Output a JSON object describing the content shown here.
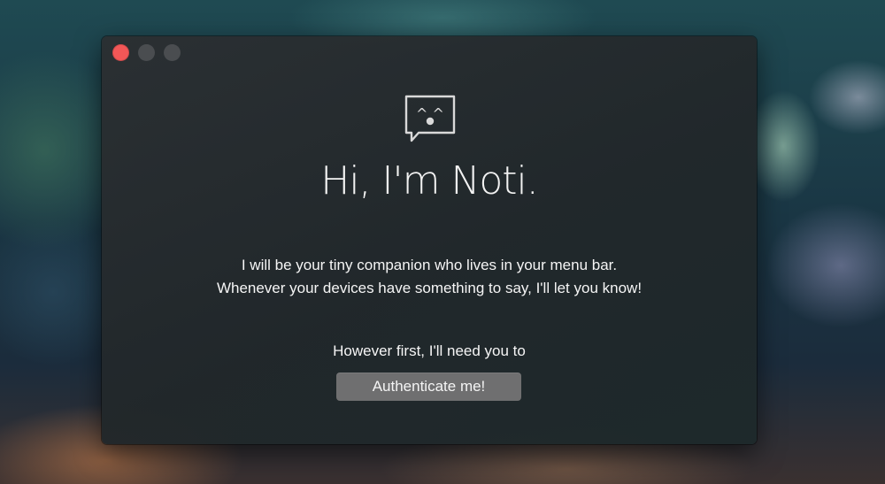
{
  "window": {
    "title": "",
    "controls": {
      "close_color": "#f25757",
      "minimize_color": "#4a4d50",
      "zoom_color": "#4a4d50"
    }
  },
  "logo": {
    "icon": "speech-bubble-face-icon",
    "face": "^ ^"
  },
  "heading": "Hi, I'm Noti.",
  "intro": {
    "line1": "I will be your tiny companion who lives in your menu bar.",
    "line2": "Whenever your devices have something to say, I'll let you know!"
  },
  "prompt": "However first, I'll need you to",
  "authenticate_button": {
    "label": "Authenticate me!",
    "color": "#6f6f70"
  }
}
